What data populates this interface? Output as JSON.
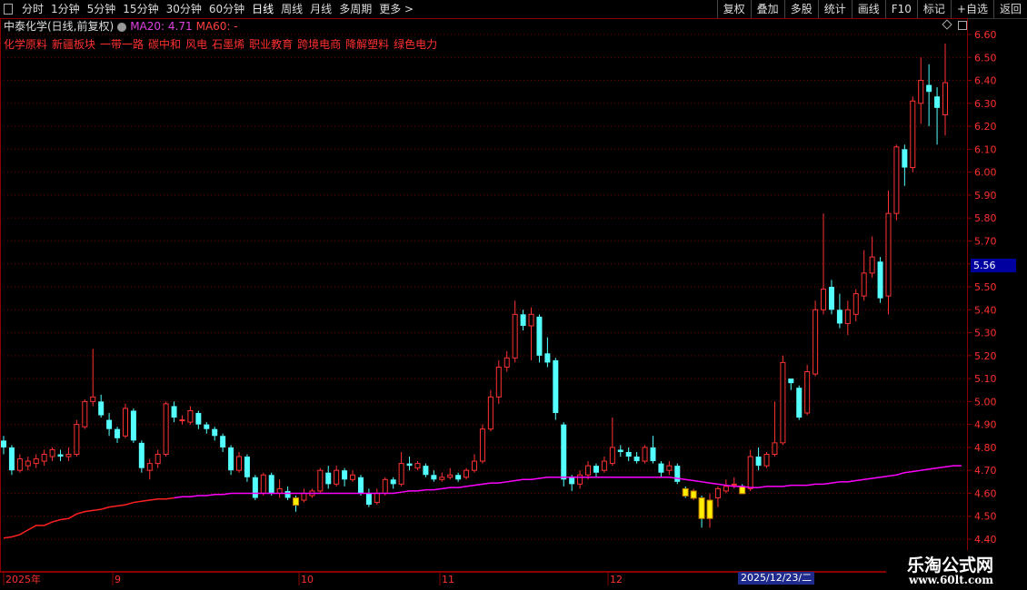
{
  "toolbar": {
    "periods": [
      "分时",
      "1分钟",
      "5分钟",
      "15分钟",
      "30分钟",
      "60分钟",
      "日线",
      "周线",
      "月线",
      "多周期",
      "更多 >"
    ],
    "active_period": "日线",
    "right_buttons": [
      "复权",
      "叠加",
      "多股",
      "统计",
      "画线",
      "F10",
      "标记",
      "+自选",
      "返回"
    ]
  },
  "info": {
    "title": "中泰化学(日线,前复权)",
    "ma20_label": "MA20: 4.71",
    "ma60_label": "MA60: -"
  },
  "concepts": [
    "化学原料",
    "新疆板块",
    "一带一路",
    "碳中和",
    "风电",
    "石墨烯",
    "职业教育",
    "跨境电商",
    "降解塑料",
    "绿色电力"
  ],
  "price_axis": {
    "labels": [
      "6.60",
      "6.50",
      "6.40",
      "6.30",
      "6.20",
      "6.10",
      "6.00",
      "5.90",
      "5.80",
      "5.70",
      "5.60",
      "5.50",
      "5.40",
      "5.30",
      "5.20",
      "5.10",
      "5.00",
      "4.90",
      "4.80",
      "4.70",
      "4.60",
      "4.50",
      "4.40"
    ],
    "current_price": "5.56"
  },
  "date_axis": {
    "labels": [
      "2025年",
      "9",
      "10",
      "11",
      "12"
    ],
    "cursor_date": "2025/12/23/二"
  },
  "colors": {
    "up": "#ff3232",
    "down": "#54ffff",
    "ma20": "#ff00ff",
    "ma_early": "#ff2020",
    "grid": "#7a0000",
    "limit": "#ffee00"
  },
  "watermark": {
    "line1": "乐淘公式网",
    "line2": "www.60lt.com"
  },
  "chart_data": {
    "type": "candlestick",
    "ylim": [
      4.4,
      6.6
    ],
    "candles": [
      [
        4.83,
        4.8,
        4.85,
        4.77
      ],
      [
        4.8,
        4.7,
        4.81,
        4.68
      ],
      [
        4.7,
        4.75,
        4.77,
        4.69
      ],
      [
        4.72,
        4.74,
        4.76,
        4.7
      ],
      [
        4.73,
        4.75,
        4.77,
        4.71
      ],
      [
        4.74,
        4.77,
        4.79,
        4.72
      ],
      [
        4.76,
        4.79,
        4.8,
        4.74
      ],
      [
        4.77,
        4.76,
        4.79,
        4.74
      ],
      [
        4.76,
        4.77,
        4.8,
        4.74
      ],
      [
        4.77,
        4.9,
        4.92,
        4.76
      ],
      [
        4.89,
        5.0,
        5.01,
        4.88
      ],
      [
        5.0,
        5.02,
        5.23,
        4.98
      ],
      [
        5.0,
        4.94,
        5.03,
        4.93
      ],
      [
        4.92,
        4.88,
        4.95,
        4.85
      ],
      [
        4.88,
        4.84,
        4.89,
        4.82
      ],
      [
        4.85,
        4.97,
        4.99,
        4.84
      ],
      [
        4.96,
        4.83,
        4.97,
        4.82
      ],
      [
        4.82,
        4.71,
        4.83,
        4.69
      ],
      [
        4.7,
        4.73,
        4.75,
        4.66
      ],
      [
        4.73,
        4.77,
        4.79,
        4.71
      ],
      [
        4.77,
        4.99,
        5.0,
        4.76
      ],
      [
        4.98,
        4.93,
        5.0,
        4.91
      ],
      [
        4.92,
        4.92,
        4.94,
        4.9
      ],
      [
        4.91,
        4.96,
        4.98,
        4.9
      ],
      [
        4.95,
        4.9,
        4.96,
        4.88
      ],
      [
        4.9,
        4.88,
        4.91,
        4.86
      ],
      [
        4.88,
        4.85,
        4.89,
        4.83
      ],
      [
        4.85,
        4.8,
        4.86,
        4.78
      ],
      [
        4.8,
        4.7,
        4.81,
        4.68
      ],
      [
        4.7,
        4.76,
        4.78,
        4.69
      ],
      [
        4.76,
        4.67,
        4.77,
        4.65
      ],
      [
        4.67,
        4.58,
        4.68,
        4.57
      ],
      [
        4.6,
        4.68,
        4.69,
        4.59
      ],
      [
        4.68,
        4.6,
        4.69,
        4.59
      ],
      [
        4.6,
        4.62,
        4.66,
        4.58
      ],
      [
        4.61,
        4.58,
        4.63,
        4.57
      ],
      [
        4.58,
        4.56,
        4.59,
        4.52
      ],
      [
        4.57,
        4.6,
        4.62,
        4.56
      ],
      [
        4.59,
        4.61,
        4.62,
        4.58
      ],
      [
        4.61,
        4.7,
        4.71,
        4.6
      ],
      [
        4.69,
        4.64,
        4.72,
        4.62
      ],
      [
        4.64,
        4.7,
        4.72,
        4.63
      ],
      [
        4.7,
        4.66,
        4.71,
        4.63
      ],
      [
        4.66,
        4.68,
        4.7,
        4.65
      ],
      [
        4.67,
        4.6,
        4.68,
        4.59
      ],
      [
        4.6,
        4.55,
        4.62,
        4.54
      ],
      [
        4.56,
        4.6,
        4.62,
        4.55
      ],
      [
        4.6,
        4.66,
        4.67,
        4.59
      ],
      [
        4.66,
        4.64,
        4.67,
        4.62
      ],
      [
        4.64,
        4.73,
        4.78,
        4.63
      ],
      [
        4.73,
        4.72,
        4.76,
        4.7
      ],
      [
        4.71,
        4.73,
        4.74,
        4.7
      ],
      [
        4.72,
        4.68,
        4.73,
        4.67
      ],
      [
        4.68,
        4.66,
        4.7,
        4.65
      ],
      [
        4.66,
        4.67,
        4.69,
        4.65
      ],
      [
        4.67,
        4.68,
        4.71,
        4.66
      ],
      [
        4.68,
        4.66,
        4.69,
        4.65
      ],
      [
        4.67,
        4.7,
        4.71,
        4.66
      ],
      [
        4.7,
        4.74,
        4.77,
        4.69
      ],
      [
        4.74,
        4.88,
        4.9,
        4.73
      ],
      [
        4.88,
        5.02,
        5.05,
        4.87
      ],
      [
        5.02,
        5.15,
        5.18,
        4.99
      ],
      [
        5.15,
        5.19,
        5.22,
        5.13
      ],
      [
        5.19,
        5.38,
        5.44,
        5.17
      ],
      [
        5.38,
        5.33,
        5.4,
        5.31
      ],
      [
        5.33,
        5.38,
        5.41,
        5.18
      ],
      [
        5.37,
        5.2,
        5.38,
        5.17
      ],
      [
        5.21,
        5.17,
        5.28,
        5.15
      ],
      [
        5.18,
        4.95,
        5.19,
        4.92
      ],
      [
        4.9,
        4.66,
        4.91,
        4.63
      ],
      [
        4.67,
        4.64,
        4.68,
        4.61
      ],
      [
        4.64,
        4.68,
        4.7,
        4.62
      ],
      [
        4.68,
        4.72,
        4.74,
        4.66
      ],
      [
        4.72,
        4.69,
        4.73,
        4.67
      ],
      [
        4.7,
        4.74,
        4.76,
        4.69
      ],
      [
        4.73,
        4.8,
        4.93,
        4.72
      ],
      [
        4.79,
        4.78,
        4.81,
        4.76
      ],
      [
        4.78,
        4.76,
        4.8,
        4.74
      ],
      [
        4.76,
        4.74,
        4.78,
        4.73
      ],
      [
        4.74,
        4.8,
        4.81,
        4.73
      ],
      [
        4.8,
        4.74,
        4.85,
        4.73
      ],
      [
        4.73,
        4.69,
        4.74,
        4.67
      ],
      [
        4.7,
        4.72,
        4.74,
        4.68
      ],
      [
        4.72,
        4.65,
        4.73,
        4.64
      ],
      [
        4.62,
        4.61,
        4.63,
        4.58
      ],
      [
        4.6,
        4.61,
        4.62,
        4.57
      ],
      [
        4.58,
        4.49,
        4.59,
        4.45
      ],
      [
        4.49,
        4.57,
        4.6,
        4.45
      ],
      [
        4.58,
        4.62,
        4.63,
        4.54
      ],
      [
        4.61,
        4.63,
        4.66,
        4.6
      ],
      [
        4.64,
        4.64,
        4.67,
        4.62
      ],
      [
        4.63,
        4.62,
        4.64,
        4.6
      ],
      [
        4.62,
        4.76,
        4.79,
        4.61
      ],
      [
        4.76,
        4.72,
        4.8,
        4.7
      ],
      [
        4.72,
        4.77,
        4.78,
        4.71
      ],
      [
        4.77,
        4.82,
        5.0,
        4.76
      ],
      [
        4.82,
        5.17,
        5.2,
        4.81
      ],
      [
        5.1,
        5.08,
        5.1,
        5.05
      ],
      [
        5.06,
        4.93,
        5.07,
        4.92
      ],
      [
        4.95,
        5.13,
        5.16,
        4.94
      ],
      [
        5.12,
        5.4,
        5.44,
        5.11
      ],
      [
        5.4,
        5.49,
        5.82,
        5.38
      ],
      [
        5.5,
        5.4,
        5.53,
        5.38
      ],
      [
        5.4,
        5.34,
        5.47,
        5.32
      ],
      [
        5.34,
        5.4,
        5.44,
        5.29
      ],
      [
        5.38,
        5.47,
        5.49,
        5.35
      ],
      [
        5.46,
        5.56,
        5.66,
        5.44
      ],
      [
        5.56,
        5.63,
        5.72,
        5.54
      ],
      [
        5.61,
        5.45,
        5.63,
        5.43
      ],
      [
        5.46,
        5.82,
        5.92,
        5.38
      ],
      [
        5.82,
        6.11,
        6.12,
        5.79
      ],
      [
        6.1,
        6.02,
        6.12,
        5.94
      ],
      [
        6.02,
        6.31,
        6.33,
        6.0
      ],
      [
        6.3,
        6.4,
        6.5,
        6.21
      ],
      [
        6.38,
        6.35,
        6.47,
        6.2
      ],
      [
        6.33,
        6.28,
        6.37,
        6.12
      ],
      [
        6.25,
        6.39,
        6.56,
        6.16
      ]
    ],
    "limit_down_indices": [
      36,
      84,
      85,
      86,
      87,
      91
    ],
    "ma20": [
      4.405,
      4.41,
      4.42,
      4.44,
      4.46,
      4.46,
      4.475,
      4.485,
      4.49,
      4.51,
      4.52,
      4.525,
      4.53,
      4.54,
      4.545,
      4.55,
      4.56,
      4.565,
      4.57,
      4.575,
      4.575,
      4.58,
      4.585,
      4.585,
      4.59,
      4.59,
      4.595,
      4.595,
      4.6,
      4.6,
      4.6,
      4.6,
      4.6,
      4.6,
      4.6,
      4.6,
      4.6,
      4.6,
      4.6,
      4.6,
      4.6,
      4.6,
      4.6,
      4.6,
      4.6,
      4.6,
      4.6,
      4.6,
      4.6,
      4.605,
      4.61,
      4.61,
      4.615,
      4.615,
      4.62,
      4.625,
      4.625,
      4.63,
      4.635,
      4.64,
      4.645,
      4.645,
      4.65,
      4.655,
      4.66,
      4.66,
      4.665,
      4.67,
      4.67,
      4.67,
      4.67,
      4.67,
      4.67,
      4.67,
      4.67,
      4.67,
      4.67,
      4.67,
      4.67,
      4.67,
      4.67,
      4.67,
      4.67,
      4.665,
      4.66,
      4.655,
      4.65,
      4.645,
      4.64,
      4.635,
      4.63,
      4.63,
      4.625,
      4.625,
      4.63,
      4.63,
      4.63,
      4.635,
      4.635,
      4.635,
      4.64,
      4.64,
      4.645,
      4.65,
      4.65,
      4.655,
      4.66,
      4.665,
      4.67,
      4.675,
      4.68,
      4.69,
      4.695,
      4.7,
      4.705,
      4.71,
      4.715,
      4.72,
      4.72
    ],
    "ma20_red_until_index": 21
  }
}
